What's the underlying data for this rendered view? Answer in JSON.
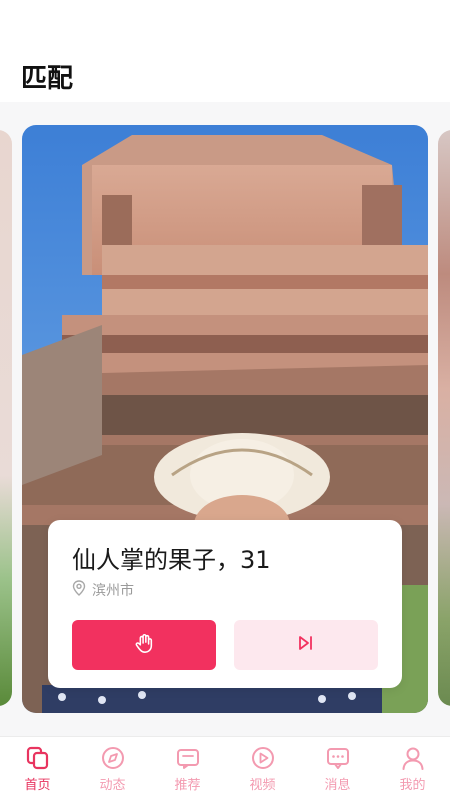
{
  "header": {
    "title": "匹配"
  },
  "profile": {
    "name_age": "仙人掌的果子，31",
    "location": "滨州市"
  },
  "colors": {
    "accent": "#f2315f",
    "accent_light": "#fde8ee",
    "tab_active": "#e8345f",
    "tab_inactive": "#f39ab0"
  },
  "tabs": [
    {
      "label": "首页",
      "icon": "home-icon",
      "active": true
    },
    {
      "label": "动态",
      "icon": "compass-icon",
      "active": false
    },
    {
      "label": "推荐",
      "icon": "recommend-icon",
      "active": false
    },
    {
      "label": "视频",
      "icon": "play-icon",
      "active": false
    },
    {
      "label": "消息",
      "icon": "message-icon",
      "active": false
    },
    {
      "label": "我的",
      "icon": "user-icon",
      "active": false
    }
  ]
}
